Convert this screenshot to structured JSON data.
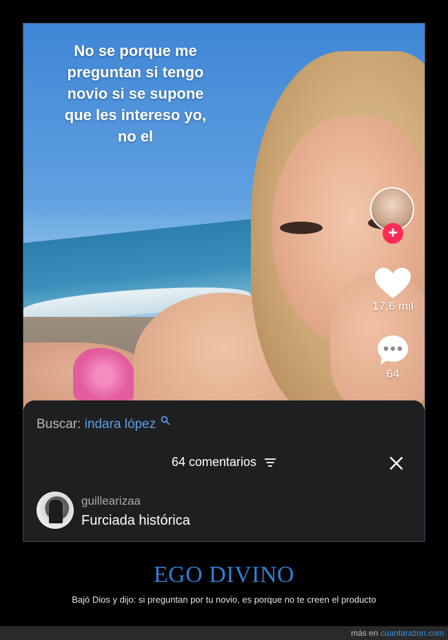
{
  "post": {
    "overlay_text": "No se porque me preguntan si tengo novio si se supone que les intereso yo, no el",
    "likes": "17,6 mil",
    "comments_count": "64",
    "follow_symbol": "+"
  },
  "comments_sheet": {
    "search_label": "Buscar:",
    "search_term": "indara lópez",
    "title": "64 comentarios",
    "comment": {
      "username": "guillearizaa",
      "text": "Furciada histórica"
    }
  },
  "site": {
    "headline": "EGO DIVINO",
    "caption": "Bajó Dios y dijo: si preguntan por tu novio, es porque no te creen el producto",
    "footer_prefix": "más en",
    "footer_link": "cuantarazon.com"
  },
  "colors": {
    "accent_blue": "#2f7fd2",
    "search_term": "#5d9fe3",
    "follow_red": "#fe2c55",
    "sheet_bg": "#1f1f21"
  },
  "icons": [
    "search-icon",
    "heart-icon",
    "comment-bubble-icon",
    "sort-icon",
    "close-icon",
    "plus-icon"
  ]
}
